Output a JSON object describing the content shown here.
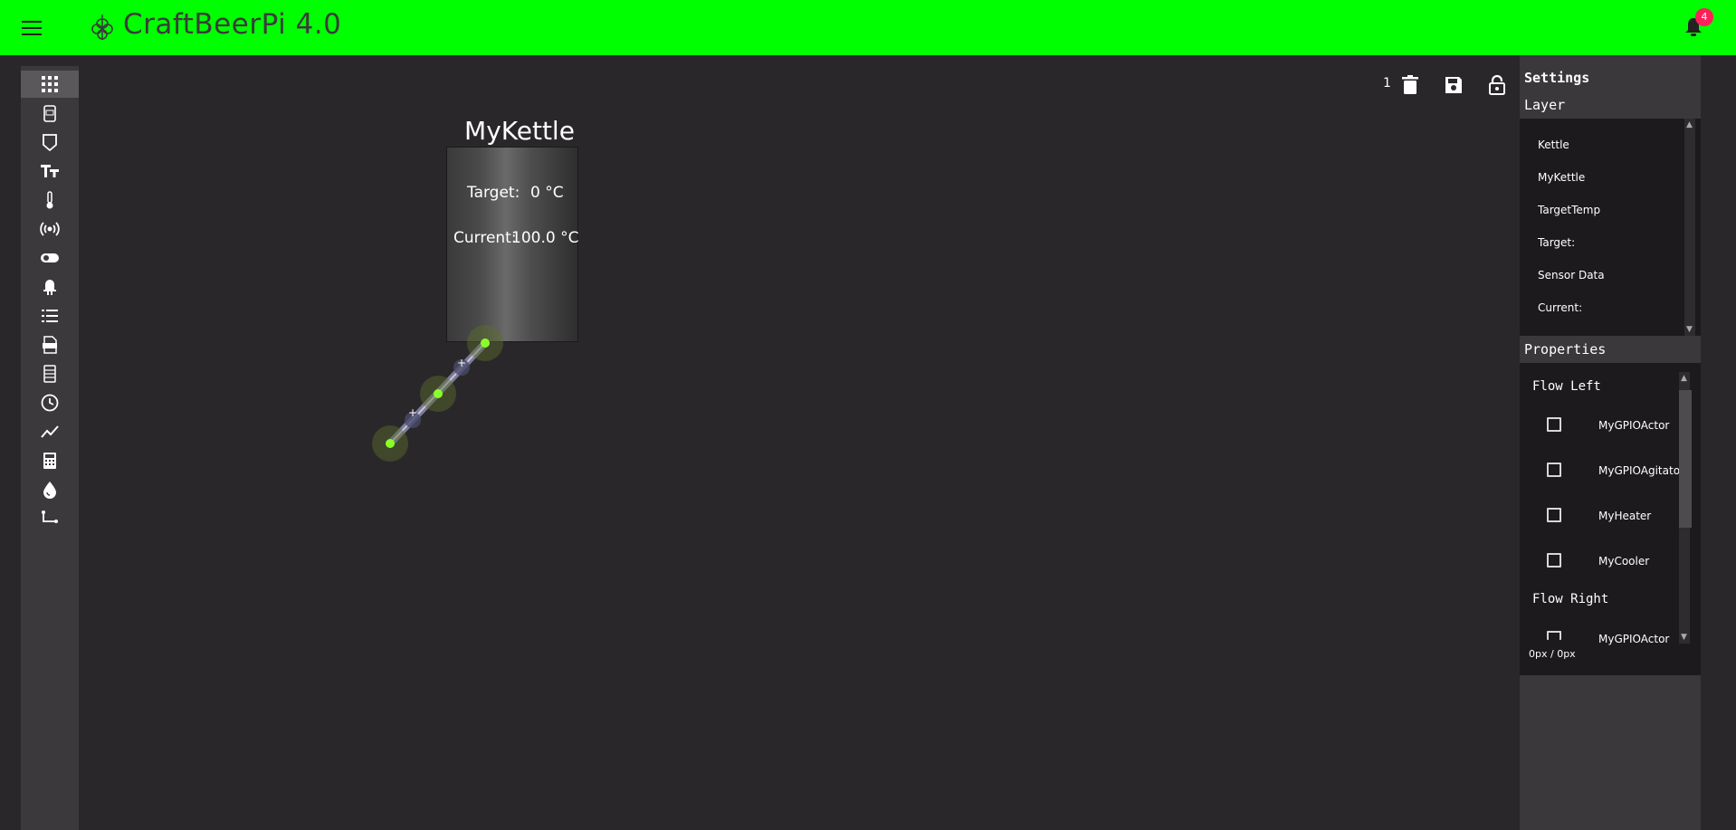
{
  "header": {
    "title": "CraftBeerPi 4.0",
    "notification_count": "4",
    "bg_color": "#00ff00"
  },
  "left_toolbar": {
    "tools": [
      {
        "icon": "grid-icon"
      },
      {
        "icon": "kettle-icon"
      },
      {
        "icon": "fermenter-icon"
      },
      {
        "icon": "text-icon"
      },
      {
        "icon": "thermometer-icon"
      },
      {
        "icon": "sensor-broadcast-icon"
      },
      {
        "icon": "toggle-icon"
      },
      {
        "icon": "led-icon"
      },
      {
        "icon": "list-icon"
      },
      {
        "icon": "svg-file-icon"
      },
      {
        "icon": "fermenter-list-icon"
      },
      {
        "icon": "clock-icon"
      },
      {
        "icon": "chart-icon"
      },
      {
        "icon": "calculator-icon"
      },
      {
        "icon": "water-drop-icon"
      },
      {
        "icon": "pipe-icon"
      }
    ]
  },
  "editor": {
    "selection_count": "1"
  },
  "kettle": {
    "title": "MyKettle",
    "target_label": "Target:",
    "target_value": "0 °C",
    "current_label": "Current:",
    "current_value": "100.0 °C"
  },
  "settings": {
    "title": "Settings",
    "layer_title": "Layer",
    "layers": [
      "Kettle",
      "MyKettle",
      "TargetTemp",
      "Target:",
      "Sensor Data",
      "Current:"
    ],
    "properties_title": "Properties",
    "flow_left_label": "Flow Left",
    "flow_left_items": [
      "MyGPIOActor",
      "MyGPIOAgitator",
      "MyHeater",
      "MyCooler"
    ],
    "flow_right_label": "Flow Right",
    "flow_right_items": [
      "MyGPIOActor"
    ],
    "coords": "0px / 0px"
  }
}
